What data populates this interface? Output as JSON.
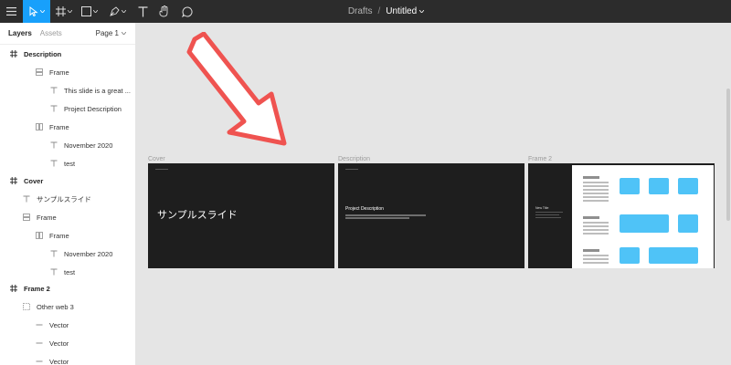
{
  "toolbar": {
    "icons": [
      "menu-icon",
      "move-icon",
      "frame-icon",
      "rectangle-icon",
      "pen-icon",
      "text-icon",
      "hand-icon",
      "comment-icon"
    ],
    "team": "Drafts",
    "separator": "/",
    "document_name": "Untitled",
    "accent_color": "#18a0fb"
  },
  "panel": {
    "tabs": {
      "layers": "Layers",
      "assets": "Assets"
    },
    "page": "Page 1",
    "layers": [
      {
        "label": "Description",
        "icon": "frame-icon",
        "top_level": true
      },
      {
        "label": "Frame",
        "icon": "auto-layout-vertical-icon"
      },
      {
        "label": "This slide is a great ...",
        "icon": "text-layer-icon"
      },
      {
        "label": "Project Description",
        "icon": "text-layer-icon"
      },
      {
        "label": "Frame",
        "icon": "auto-layout-horizontal-icon"
      },
      {
        "label": "November 2020",
        "icon": "text-layer-icon"
      },
      {
        "label": "test",
        "icon": "text-layer-icon"
      },
      {
        "label": "Cover",
        "icon": "frame-icon",
        "top_level": true
      },
      {
        "label": "サンプルスライド",
        "icon": "text-layer-icon"
      },
      {
        "label": "Frame",
        "icon": "auto-layout-vertical-icon"
      },
      {
        "label": "Frame",
        "icon": "auto-layout-horizontal-icon"
      },
      {
        "label": "November 2020",
        "icon": "text-layer-icon"
      },
      {
        "label": "test",
        "icon": "text-layer-icon"
      },
      {
        "label": "Frame 2",
        "icon": "frame-icon",
        "top_level": true
      },
      {
        "label": "Other web 3",
        "icon": "component-instance-icon"
      },
      {
        "label": "Vector",
        "icon": "vector-line-icon"
      },
      {
        "label": "Vector",
        "icon": "vector-line-icon"
      },
      {
        "label": "Vector",
        "icon": "vector-line-icon"
      }
    ]
  },
  "canvas": {
    "background": "#e5e5e5",
    "frames": [
      {
        "label": "Cover",
        "title": "サンプルスライド"
      },
      {
        "label": "Description",
        "title": "Project Description"
      },
      {
        "label": "Frame 2",
        "title": "New Title"
      }
    ],
    "annotation": {
      "icon": "red-arrow-icon",
      "color": "#ef5350"
    }
  }
}
